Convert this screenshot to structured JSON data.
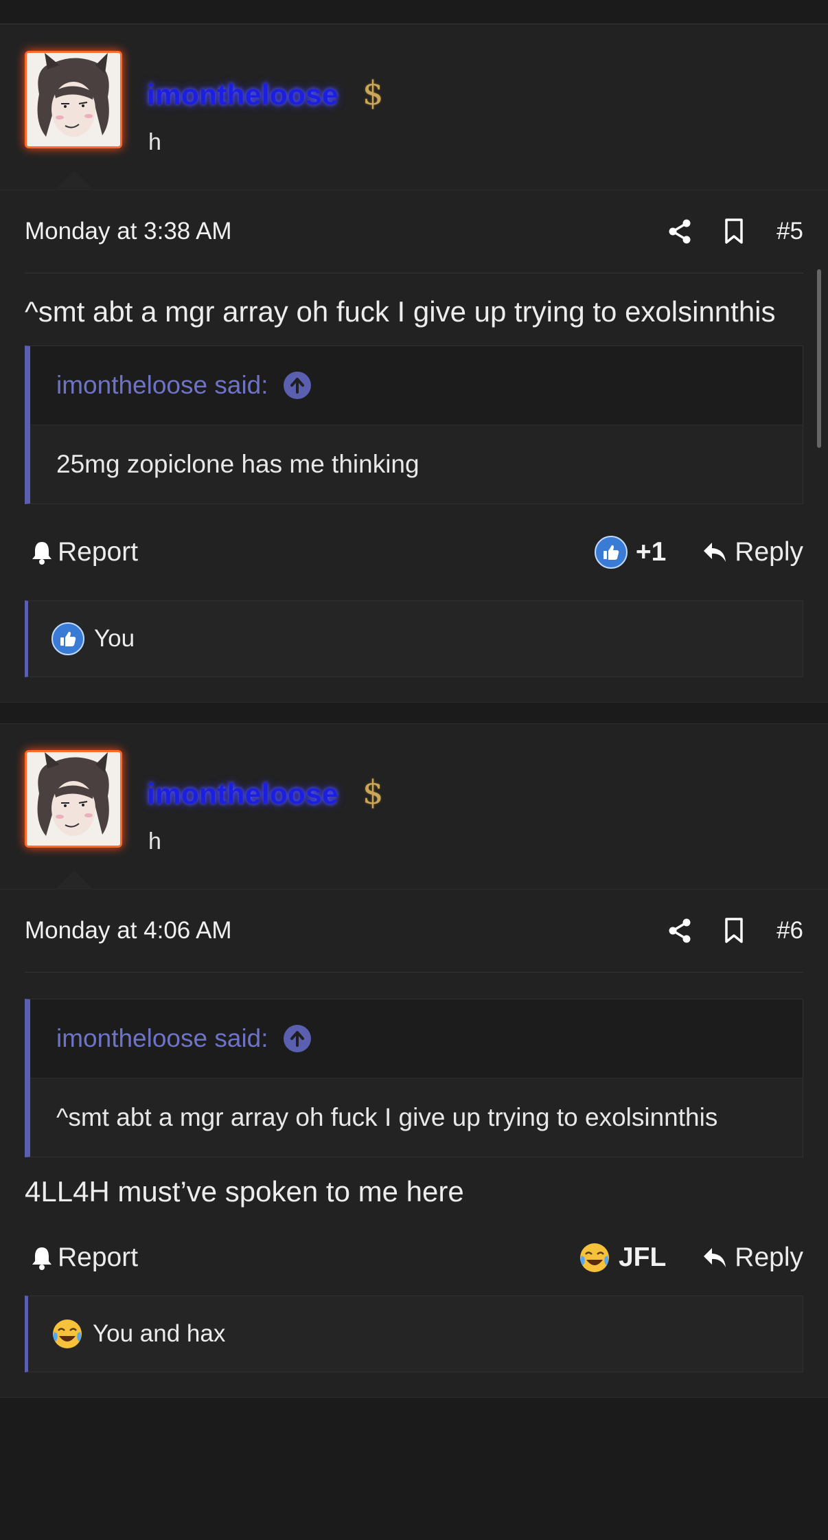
{
  "posts": [
    {
      "username": "imontheloose",
      "user_title": "h",
      "date": "Monday at 3:38 AM",
      "number": "#5",
      "message_before": "^smt abt a mgr array oh fuck I give up trying to exolsinnthis",
      "quote": {
        "author": "imontheloose said:",
        "text": "25mg zopiclone has me thinking"
      },
      "message_after": "",
      "report_label": "Report",
      "reaction_label": "+1",
      "reaction_icon": "like-icon",
      "reply_label": "Reply",
      "reactions_summary": "You"
    },
    {
      "username": "imontheloose",
      "user_title": "h",
      "date": "Monday at 4:06 AM",
      "number": "#6",
      "message_before": "",
      "quote": {
        "author": "imontheloose said:",
        "text": "^smt abt a mgr array oh fuck I give up trying to exolsinnthis"
      },
      "message_after": "4LL4H must’ve spoken to me here",
      "report_label": "Report",
      "reaction_label": "JFL",
      "reaction_icon": "crying-laughing-icon",
      "reply_label": "Reply",
      "reactions_summary": "You and hax"
    }
  ],
  "colors": {
    "accent": "#5a5fb0",
    "username": "#1b1fe0",
    "avatar_border": "#ff6a2a",
    "background": "#1b1b1c"
  }
}
